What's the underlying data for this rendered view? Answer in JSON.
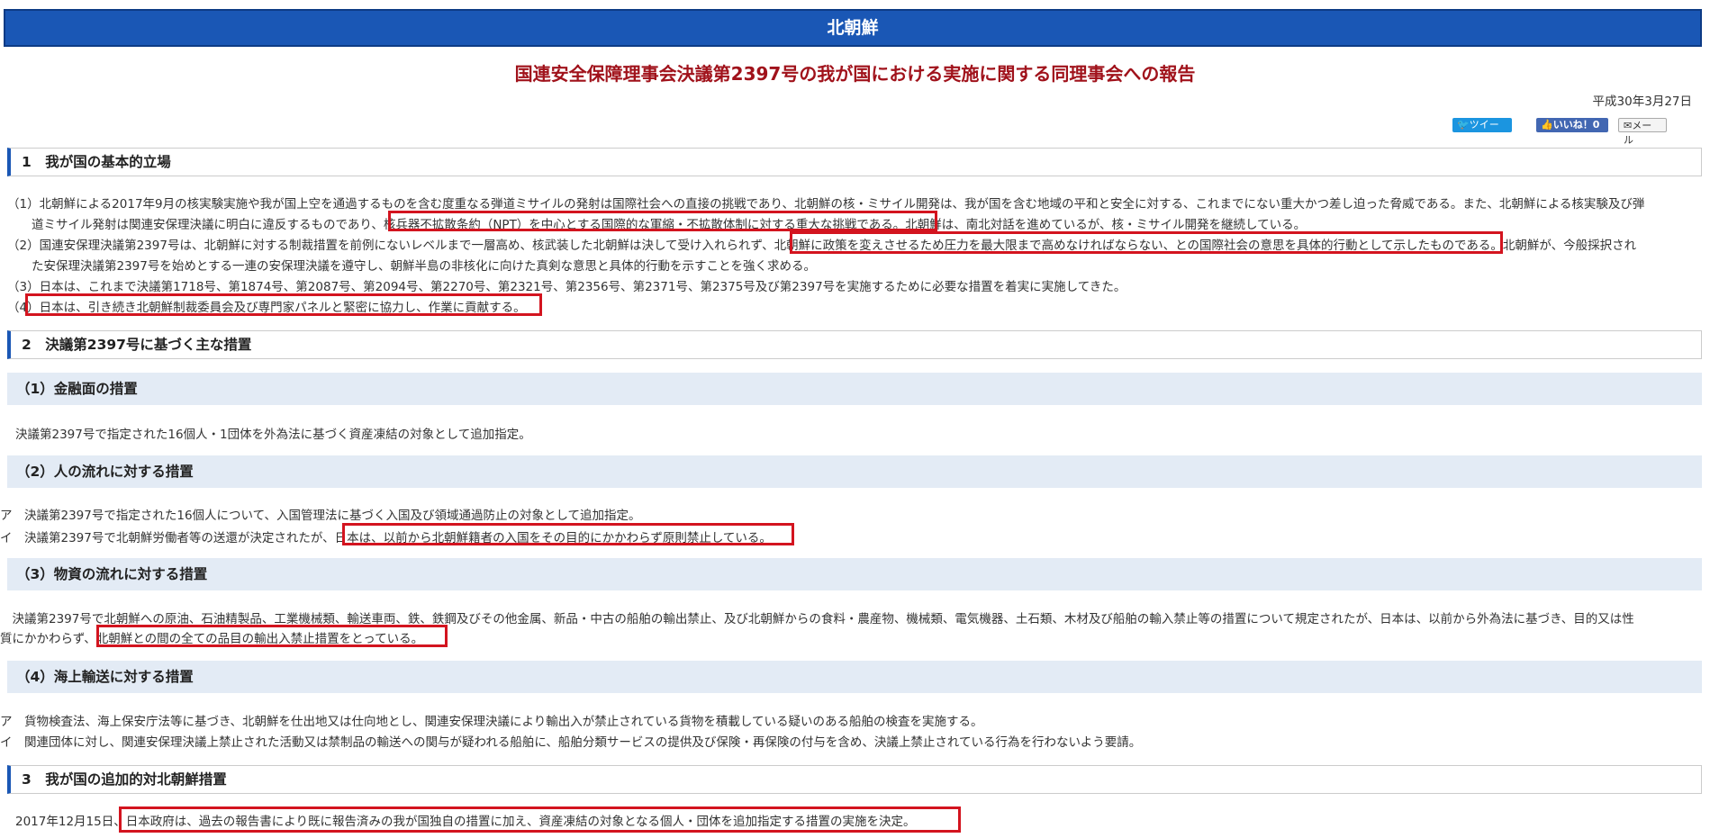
{
  "header": {
    "title": "北朝鮮"
  },
  "report": {
    "title": "国連安全保障理事会決議第2397号の我が国における実施に関する同理事会への報告",
    "date": "平成30年3月27日"
  },
  "share": {
    "tweet": "ツイート",
    "like": "いいね！0",
    "mail": "メール"
  },
  "sections": {
    "s1": {
      "heading": "1　我が国の基本的立場",
      "lines": [
        "（1）北朝鮮による2017年9月の核実験実施や我が国上空を通過するものを含む度重なる弾道ミサイルの発射は国際社会への直接の挑戦であり、北朝鮮の核・ミサイル開発は、我が国を含む地域の平和と安全に対する、これまでにない重大かつ差し迫った脅威である。また、北朝鮮による核実験及び弾",
        "　　道ミサイル発射は関連安保理決議に明白に違反するものであり、核兵器不拡散条約（NPT）を中心とする国際的な軍縮・不拡散体制に対する重大な挑戦である。北朝鮮は、南北対話を進めているが、核・ミサイル開発を継続している。",
        "（2）国連安保理決議第2397号は、北朝鮮に対する制裁措置を前例にないレベルまで一層高め、核武装した北朝鮮は決して受け入れられず、北朝鮮に政策を変えさせるため圧力を最大限まで高めなければならない、との国際社会の意思を具体的行動として示したものである。北朝鮮が、今般採択され",
        "　　た安保理決議第2397号を始めとする一連の安保理決議を遵守し、朝鮮半島の非核化に向けた真剣な意思と具体的行動を示すことを強く求める。",
        "（3）日本は、これまで決議第1718号、第1874号、第2087号、第2094号、第2270号、第2321号、第2356号、第2371号、第2375号及び第2397号を実施するために必要な措置を着実に実施してきた。",
        "（4）日本は、引き続き北朝鮮制裁委員会及び専門家パネルと緊密に協力し、作業に貢献する。"
      ]
    },
    "s2": {
      "heading": "2　決議第2397号に基づく主な措置",
      "sub1": {
        "heading": "（1）金融面の措置",
        "text": "決議第2397号で指定された16個人・1団体を外為法に基づく資産凍結の対象として追加指定。"
      },
      "sub2": {
        "heading": "（2）人の流れに対する措置",
        "lines": [
          "ア　決議第2397号で指定された16個人について、入国管理法に基づく入国及び領域通過防止の対象として追加指定。",
          "イ　決議第2397号で北朝鮮労働者等の送還が決定されたが、日本は、以前から北朝鮮籍者の入国をその目的にかかわらず原則禁止している。"
        ]
      },
      "sub3": {
        "heading": "（3）物資の流れに対する措置",
        "lines": [
          "　決議第2397号で北朝鮮への原油、石油精製品、工業機械類、輸送車両、鉄、鉄鋼及びその他金属、新品・中古の船舶の輸出禁止、及び北朝鮮からの食料・農産物、機械類、電気機器、土石類、木材及び船舶の輸入禁止等の措置について規定されたが、日本は、以前から外為法に基づき、目的又は性",
          "質にかかわらず、北朝鮮との間の全ての品目の輸出入禁止措置をとっている。"
        ]
      },
      "sub4": {
        "heading": "（4）海上輸送に対する措置",
        "lines": [
          "ア　貨物検査法、海上保安庁法等に基づき、北朝鮮を仕出地又は仕向地とし、関連安保理決議により輸出入が禁止されている貨物を積載している疑いのある船舶の検査を実施する。",
          "イ　関連団体に対し、関連安保理決議上禁止された活動又は禁制品の輸送への関与が疑われる船舶に、船舶分類サービスの提供及び保険・再保険の付与を含め、決議上禁止されている行為を行わないよう要請。"
        ]
      }
    },
    "s3": {
      "heading": "3　我が国の追加的対北朝鮮措置",
      "text": "2017年12月15日、日本政府は、過去の報告書により既に報告済みの我が国独自の措置に加え、資産凍結の対象となる個人・団体を追加指定する措置の実施を決定。"
    }
  },
  "colors": {
    "header_bg": "#1a57b5",
    "title_red": "#a0121b",
    "highlight_box": "#d3141f",
    "sub_bg": "#e3ebf5"
  }
}
